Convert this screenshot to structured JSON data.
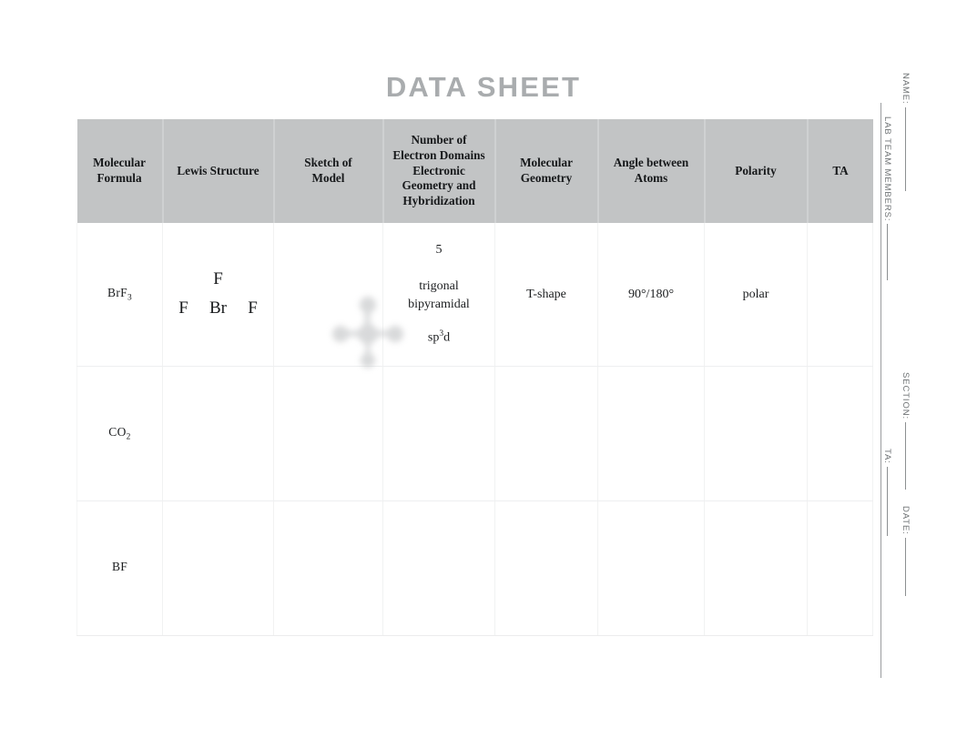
{
  "title": "DATA SHEET",
  "table": {
    "columns": [
      {
        "key": "molecular_formula",
        "label": "Molecular\nFormula"
      },
      {
        "key": "lewis_structure",
        "label": "Lewis Structure"
      },
      {
        "key": "sketch_of_model",
        "label": "Sketch of\nModel"
      },
      {
        "key": "electron_domains",
        "label": "Number of\nElectron Domains\nElectronic\nGeometry and\nHybridization"
      },
      {
        "key": "molecular_geometry",
        "label": "Molecular\nGeometry"
      },
      {
        "key": "angle_between_atoms",
        "label": "Angle between\nAtoms"
      },
      {
        "key": "polarity",
        "label": "Polarity"
      },
      {
        "key": "ta",
        "label": "TA"
      }
    ],
    "header_labels": {
      "molecular_formula_l1": "Molecular",
      "molecular_formula_l2": "Formula",
      "lewis_structure": "Lewis Structure",
      "sketch_of_model_l1": "Sketch of",
      "sketch_of_model_l2": "Model",
      "electron_domains_l1": "Number of",
      "electron_domains_l2": "Electron Domains",
      "electron_domains_l3": "Electronic",
      "electron_domains_l4": "Geometry and",
      "electron_domains_l5": "Hybridization",
      "molecular_geometry_l1": "Molecular",
      "molecular_geometry_l2": "Geometry",
      "angle_between_atoms_l1": "Angle between",
      "angle_between_atoms_l2": "Atoms",
      "polarity": "Polarity",
      "ta": "TA"
    },
    "rows": [
      {
        "formula_main": "BrF",
        "formula_sub": "3",
        "lewis": {
          "top": "F",
          "left": "F",
          "center": "Br",
          "right": "F"
        },
        "model_icon": "molecular-model-sketch",
        "domains_count": "5",
        "electronic_geometry_l1": "trigonal",
        "electronic_geometry_l2": "bipyramidal",
        "hybridization_main": "sp",
        "hybridization_sup": "3",
        "hybridization_tail": "d",
        "molecular_geometry": "T-shape",
        "angle_between_atoms": "90°/180°",
        "polarity": "polar",
        "ta": ""
      },
      {
        "formula_main": "CO",
        "formula_sub": "2",
        "lewis": {
          "top": "",
          "left": "",
          "center": "",
          "right": ""
        },
        "model_icon": "",
        "domains_count": "",
        "electronic_geometry_l1": "",
        "electronic_geometry_l2": "",
        "hybridization_main": "",
        "hybridization_sup": "",
        "hybridization_tail": "",
        "molecular_geometry": "",
        "angle_between_atoms": "",
        "polarity": "",
        "ta": ""
      },
      {
        "formula_main": "BF",
        "formula_sub": "",
        "lewis": {
          "top": "",
          "left": "",
          "center": "",
          "right": ""
        },
        "model_icon": "",
        "domains_count": "",
        "electronic_geometry_l1": "",
        "electronic_geometry_l2": "",
        "hybridization_main": "",
        "hybridization_sup": "",
        "hybridization_tail": "",
        "molecular_geometry": "",
        "angle_between_atoms": "",
        "polarity": "",
        "ta": ""
      }
    ]
  },
  "margin_fields": {
    "name": "NAME:",
    "lab_team_members": "LAB TEAM MEMBERS:",
    "section": "SECTION:",
    "ta": "TA:",
    "date": "DATE:"
  },
  "colors": {
    "title": "#a9acae",
    "header_band": "#c2c4c5",
    "grid_line": "#f1f2f2",
    "margin_rule": "#9a9d9f",
    "margin_label": "#6e7274",
    "body_text": "#1b1d1f"
  }
}
